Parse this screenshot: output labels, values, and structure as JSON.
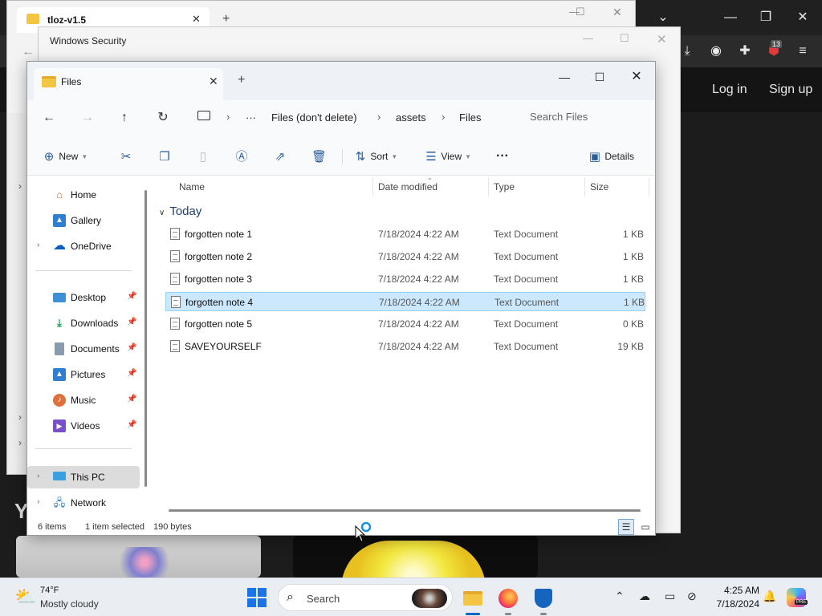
{
  "background_browser": {
    "tab_title": "tloz-v1.5",
    "extension_badge": "13",
    "login_label": "Log in",
    "signup_label": "Sign up",
    "partial_letter": "Y"
  },
  "security_dialog": {
    "title": "Windows Security"
  },
  "explorer": {
    "tab_title": "Files",
    "breadcrumb": [
      "Files (don't delete)",
      "assets",
      "Files"
    ],
    "breadcrumb_more": "···",
    "search_placeholder": "Search Files",
    "commands": {
      "new": "New",
      "sort": "Sort",
      "view": "View",
      "more": "···",
      "details": "Details"
    },
    "nav_pane": [
      {
        "label": "Home",
        "icon": "home-icon",
        "expandable": false,
        "pinned": false
      },
      {
        "label": "Gallery",
        "icon": "gallery-icon",
        "expandable": false,
        "pinned": false
      },
      {
        "label": "OneDrive",
        "icon": "cloud-icon",
        "expandable": true,
        "pinned": false
      },
      {
        "label": "Desktop",
        "icon": "desktop-icon",
        "expandable": false,
        "pinned": true
      },
      {
        "label": "Downloads",
        "icon": "download-icon",
        "expandable": false,
        "pinned": true
      },
      {
        "label": "Documents",
        "icon": "documents-icon",
        "expandable": false,
        "pinned": true
      },
      {
        "label": "Pictures",
        "icon": "pictures-icon",
        "expandable": false,
        "pinned": true
      },
      {
        "label": "Music",
        "icon": "music-icon",
        "expandable": false,
        "pinned": true
      },
      {
        "label": "Videos",
        "icon": "videos-icon",
        "expandable": false,
        "pinned": true
      },
      {
        "label": "This PC",
        "icon": "computer-icon",
        "expandable": true,
        "pinned": false,
        "active": true
      },
      {
        "label": "Network",
        "icon": "network-icon",
        "expandable": true,
        "pinned": false
      }
    ],
    "columns": {
      "name": "Name",
      "date": "Date modified",
      "type": "Type",
      "size": "Size"
    },
    "group_label": "Today",
    "files": [
      {
        "name": "forgotten note 1",
        "date": "7/18/2024 4:22 AM",
        "type": "Text Document",
        "size": "1 KB",
        "selected": false
      },
      {
        "name": "forgotten note 2",
        "date": "7/18/2024 4:22 AM",
        "type": "Text Document",
        "size": "1 KB",
        "selected": false
      },
      {
        "name": "forgotten note 3",
        "date": "7/18/2024 4:22 AM",
        "type": "Text Document",
        "size": "1 KB",
        "selected": false
      },
      {
        "name": "forgotten note 4",
        "date": "7/18/2024 4:22 AM",
        "type": "Text Document",
        "size": "1 KB",
        "selected": true
      },
      {
        "name": "forgotten note 5",
        "date": "7/18/2024 4:22 AM",
        "type": "Text Document",
        "size": "0 KB",
        "selected": false
      },
      {
        "name": "SAVEYOURSELF",
        "date": "7/18/2024 4:22 AM",
        "type": "Text Document",
        "size": "19 KB",
        "selected": false
      }
    ],
    "status": {
      "items": "6 items",
      "selected": "1 item selected",
      "bytes": "190 bytes"
    }
  },
  "taskbar": {
    "weather_temp": "74°F",
    "weather_desc": "Mostly cloudy",
    "search_label": "Search",
    "time": "4:25 AM",
    "date": "7/18/2024",
    "copilot_badge": "PRE"
  },
  "colors": {
    "accent": "#0067c0",
    "selection": "#cce8ff",
    "folder": "#f4c542"
  }
}
